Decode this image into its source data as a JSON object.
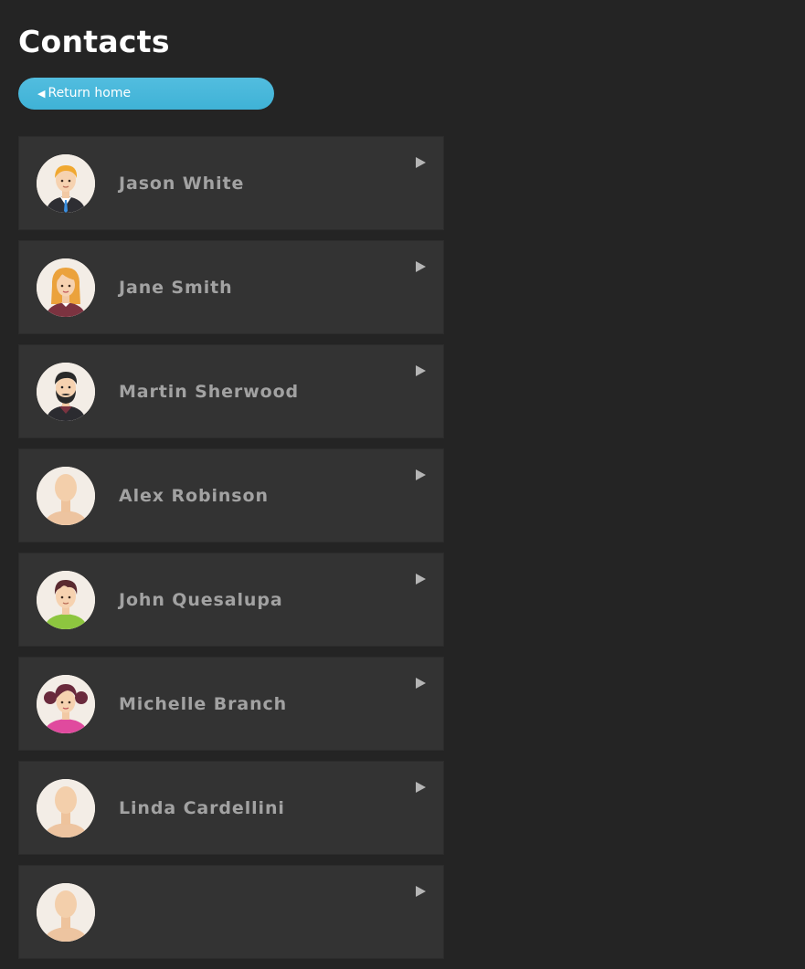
{
  "page": {
    "title": "Contacts"
  },
  "back_button": {
    "arrow": "◀",
    "label": "Return home"
  },
  "contacts": [
    {
      "name": "Jason White",
      "avatar": "man-blond-suit-avatar"
    },
    {
      "name": "Jane Smith",
      "avatar": "woman-ginger-avatar"
    },
    {
      "name": "Martin Sherwood",
      "avatar": "man-bearded-avatar"
    },
    {
      "name": "Alex Robinson",
      "avatar": "default-avatar"
    },
    {
      "name": "John Quesalupa",
      "avatar": "man-brown-hair-green-shirt-avatar"
    },
    {
      "name": "Michelle Branch",
      "avatar": "girl-pigtails-pink-shirt-avatar"
    },
    {
      "name": "Linda Cardellini",
      "avatar": "default-avatar"
    },
    {
      "name": "",
      "avatar": "default-avatar"
    }
  ],
  "icons": {
    "chevron": "chevron-right-icon"
  },
  "colors": {
    "background": "#242424",
    "card": "#333333",
    "accent": "#46b6da",
    "name_text": "#a2a2a2",
    "title_text": "#ffffff"
  }
}
